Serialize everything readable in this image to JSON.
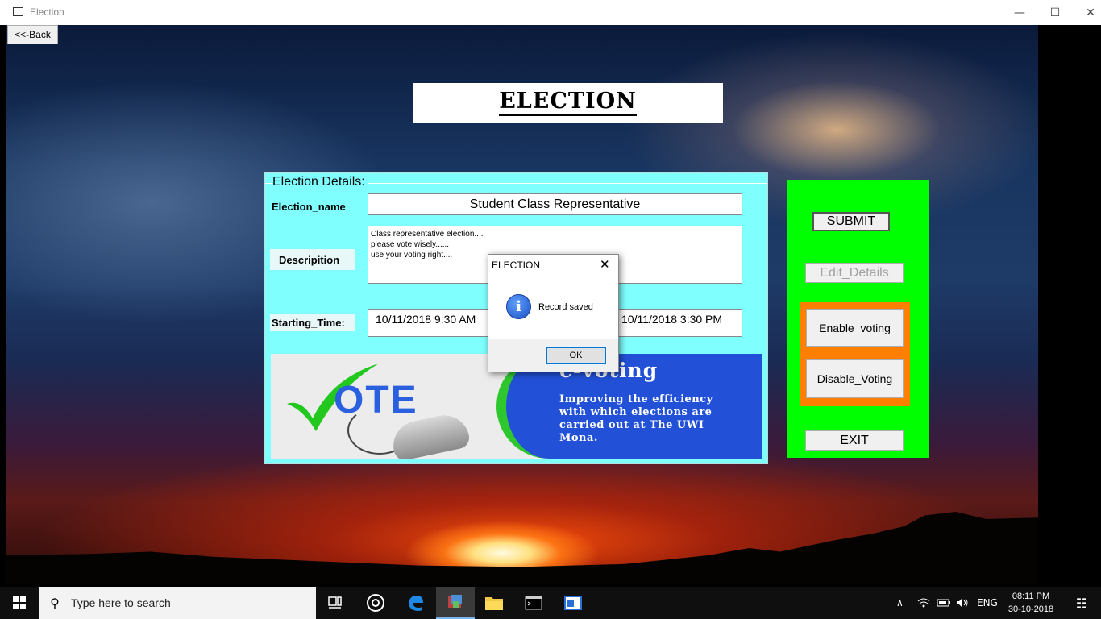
{
  "window": {
    "title": "Election",
    "minimize": "—",
    "maximize": "☐",
    "close": "✕"
  },
  "back_button": "<<-Back",
  "page_title": "ELECTION",
  "details": {
    "legend": "Election  Details:",
    "name_label": "Election_name",
    "name_value": "Student Class Representative",
    "description_label": "Descripition",
    "description_value": "Class representative election....\nplease vote wisely......\nuse your voting right....",
    "start_label": "Starting_Time:",
    "start_value": "10/11/2018 9:30 AM",
    "end_value": "10/11/2018 3:30 PM"
  },
  "banner": {
    "vote_word": "OTE",
    "evote_title": "e-voting",
    "evote_subtitle": "Improving the efficiency\nwith which elections are\ncarried out at The UWI\nMona."
  },
  "panel": {
    "submit": "SUBMIT",
    "edit": "Edit_Details",
    "enable": "Enable_voting",
    "disable": "Disable_Voting",
    "exit": "EXIT"
  },
  "dialog": {
    "title": "ELECTION",
    "close": "✕",
    "icon": "i",
    "message": "Record saved",
    "ok": "OK"
  },
  "taskbar": {
    "search_placeholder": "Type here to search",
    "search_icon": "⚲",
    "language": "ENG",
    "time": "08:11 PM",
    "date": "30-10-2018",
    "tray_chevron": "∧",
    "notification_icon": "☷"
  },
  "colors": {
    "details_bg": "#80ffff",
    "panel_bg": "#00ff00",
    "orange_bg": "#ff8000",
    "banner_blue": "#2251d8"
  }
}
